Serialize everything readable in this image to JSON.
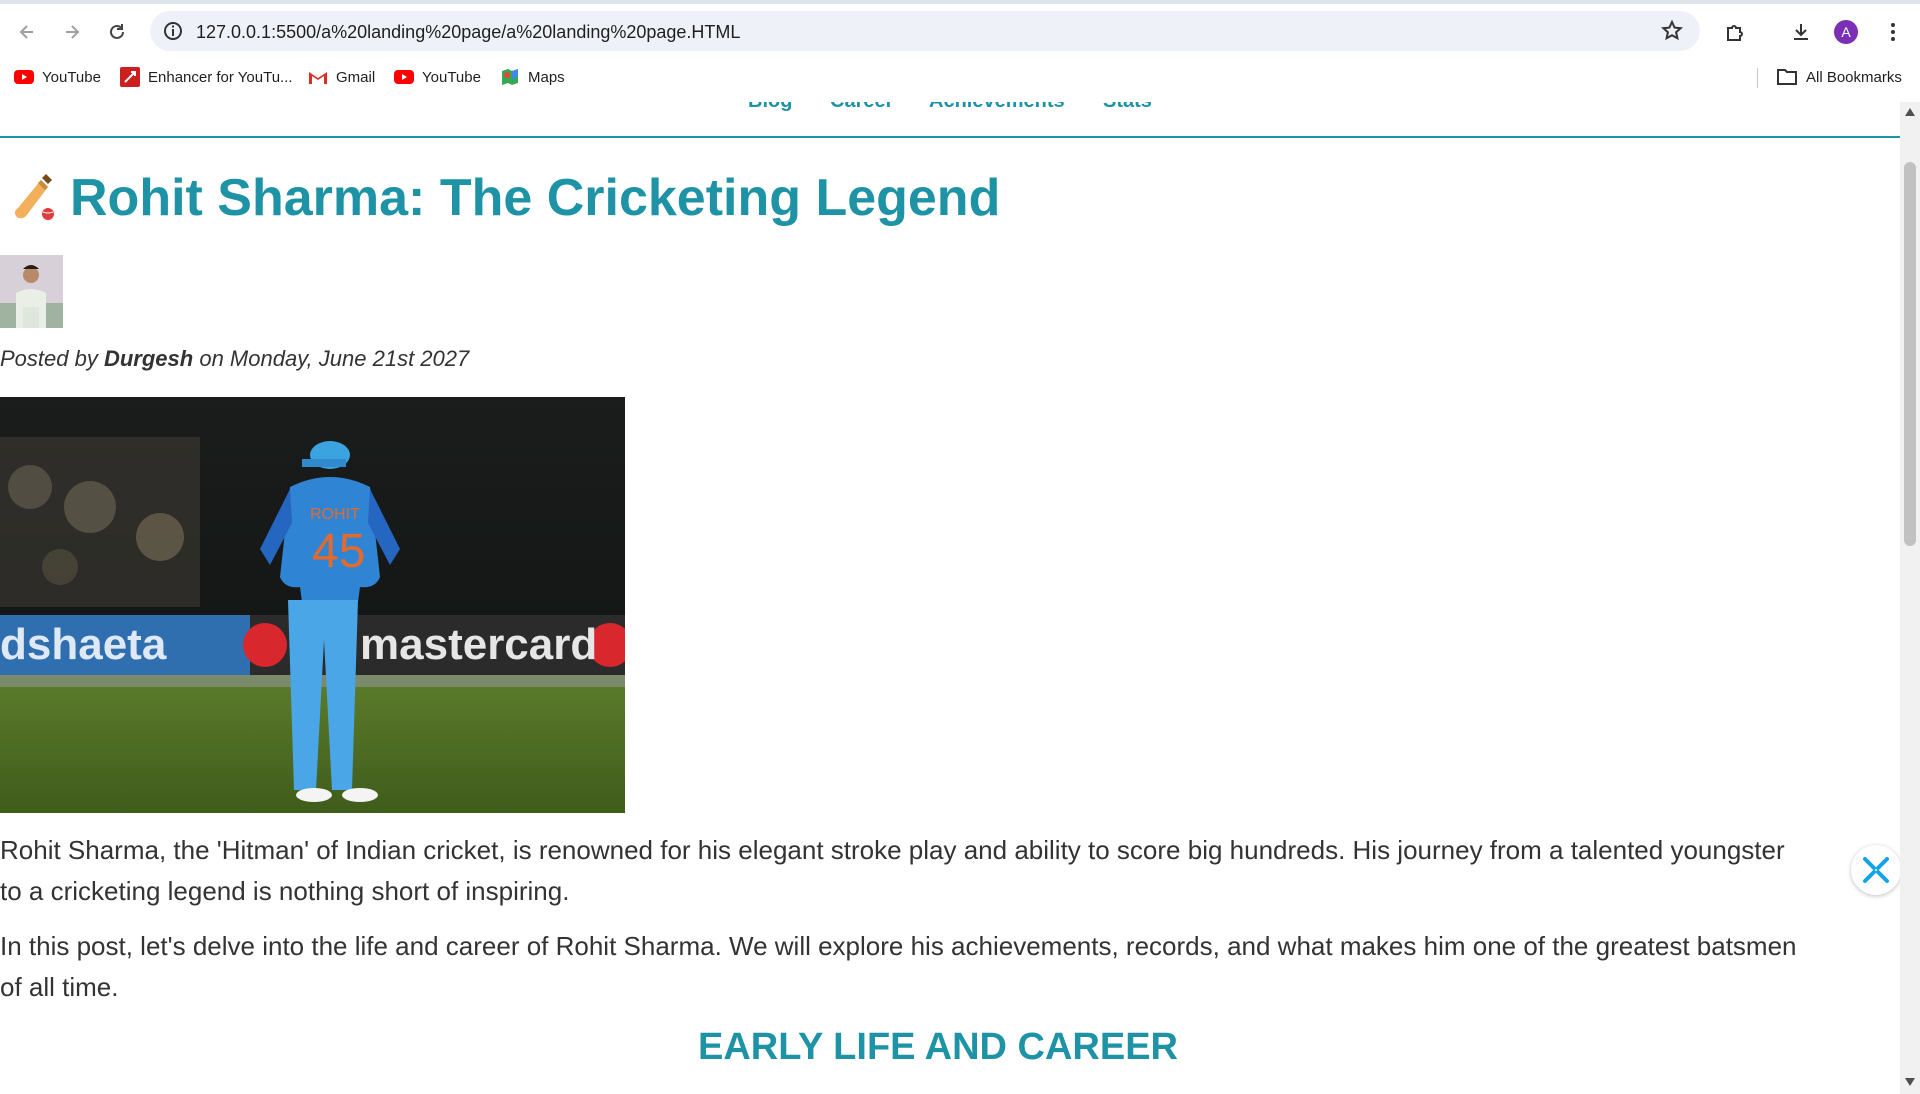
{
  "browser": {
    "url": "127.0.0.1:5500/a%20landing%20page/a%20landing%20page.HTML",
    "avatar_letter": "A",
    "bookmarks": [
      {
        "label": "YouTube",
        "icon": "youtube-icon"
      },
      {
        "label": "Enhancer for YouTu...",
        "icon": "enhancer-icon"
      },
      {
        "label": "Gmail",
        "icon": "gmail-icon"
      },
      {
        "label": "YouTube",
        "icon": "youtube-icon"
      },
      {
        "label": "Maps",
        "icon": "maps-icon"
      }
    ],
    "all_bookmarks": "All Bookmarks"
  },
  "site_nav": {
    "items": [
      "Blog",
      "Career",
      "Achievements",
      "Stats"
    ]
  },
  "post": {
    "title_icon": "🏏",
    "title": "Rohit Sharma: The Cricketing Legend",
    "posted_prefix": "Posted by",
    "author": "Durgesh",
    "posted_suffix": "on Monday, June 21st 2027",
    "para1": "Rohit Sharma, the 'Hitman' of Indian cricket, is renowned for his elegant stroke play and ability to score big hundreds. His journey from a talented youngster to a cricketing legend is nothing short of inspiring.",
    "para2": "In this post, let's delve into the life and career of Rohit Sharma. We will explore his achievements, records, and what makes him one of the greatest batsmen of all time.",
    "section_heading": "EARLY LIFE AND CAREER"
  },
  "hero_image": {
    "jersey_name": "ROHIT",
    "jersey_number": "45",
    "board_left": "dshaeta",
    "board_right": "mastercard"
  },
  "colors": {
    "accent": "#1e93a6",
    "text": "#333333"
  }
}
